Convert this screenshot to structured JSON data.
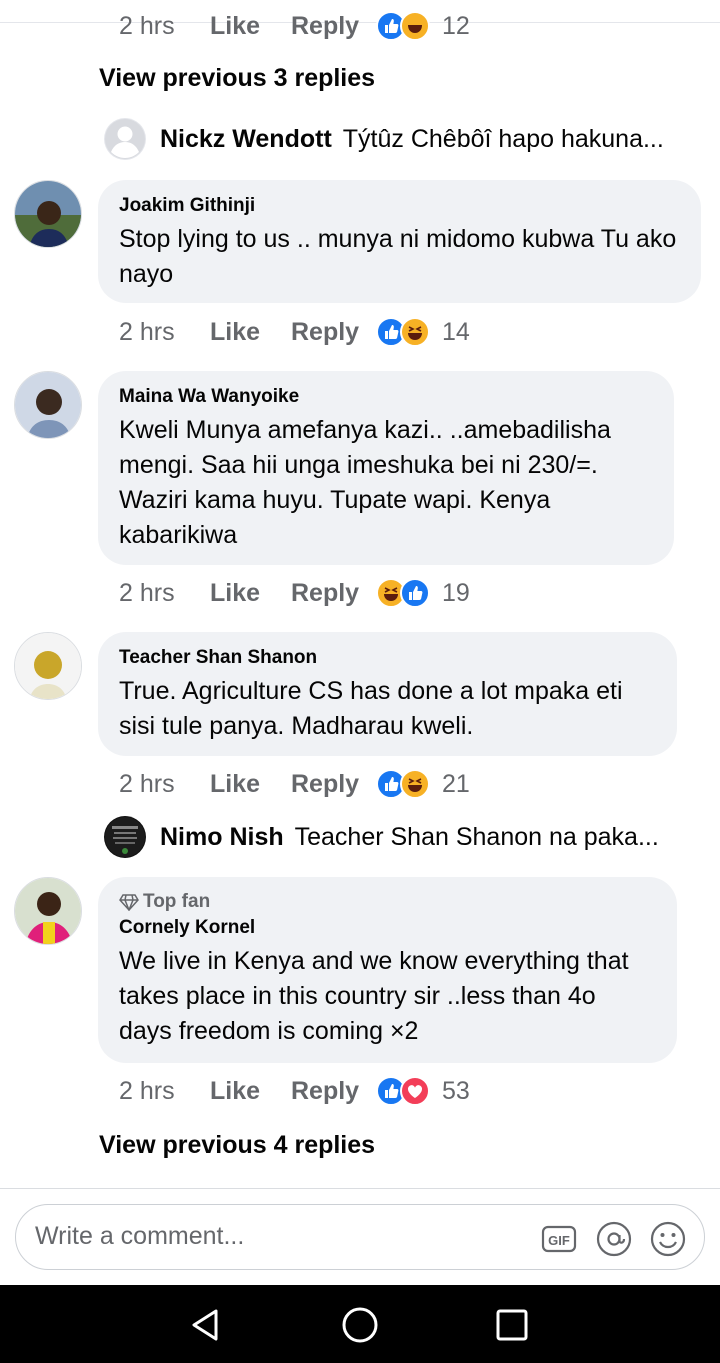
{
  "top_partial": {
    "time": "2 hrs",
    "like": "Like",
    "reply": "Reply",
    "count": "12"
  },
  "view_prev_1": "View previous 3 replies",
  "reply_nickz": {
    "name": "Nickz Wendott",
    "text": "Týtûz Chêbôî hapo hakuna..."
  },
  "comments": [
    {
      "author": "Joakim Githinji",
      "text": "Stop lying to us ..   munya ni midomo kubwa Tu ako nayo",
      "time": "2 hrs",
      "like": "Like",
      "reply": "Reply",
      "reactions": [
        "like",
        "haha"
      ],
      "count": "14"
    },
    {
      "author": "Maina Wa Wanyoike",
      "text": "Kweli Munya amefanya kazi..  ..amebadilisha mengi. Saa hii unga imeshuka bei ni 230/=. Waziri kama huyu. Tupate wapi. Kenya kabarikiwa",
      "time": "2 hrs",
      "like": "Like",
      "reply": "Reply",
      "reactions": [
        "haha",
        "like"
      ],
      "count": "19"
    },
    {
      "author": "Teacher Shan Shanon",
      "text": "True. Agriculture CS has done a lot mpaka eti sisi tule panya. Madharau kweli.",
      "time": "2 hrs",
      "like": "Like",
      "reply": "Reply",
      "reactions": [
        "like",
        "haha"
      ],
      "count": "21"
    },
    {
      "badge": "Top fan",
      "author": "Cornely Kornel",
      "text": "We live in Kenya and we know everything that takes place in this country sir ..less than 4o days freedom is coming ×2",
      "time": "2 hrs",
      "like": "Like",
      "reply": "Reply",
      "reactions": [
        "like",
        "love"
      ],
      "count": "53"
    }
  ],
  "reply_nimo": {
    "name": "Nimo Nish",
    "text": "Teacher Shan Shanon na paka..."
  },
  "view_prev_2": "View previous 4 replies",
  "composer": {
    "placeholder": "Write a comment...",
    "icons": [
      "gif-icon",
      "mention-icon",
      "emoji-icon"
    ]
  },
  "navbar": {
    "icons": [
      "back-icon",
      "home-icon",
      "recents-icon"
    ]
  },
  "colors": {
    "like_blue": "#1877f2",
    "haha_yellow": "#f7b125",
    "love_red": "#f33e58",
    "bubble": "#f0f2f5",
    "meta_gray": "#65676b"
  }
}
